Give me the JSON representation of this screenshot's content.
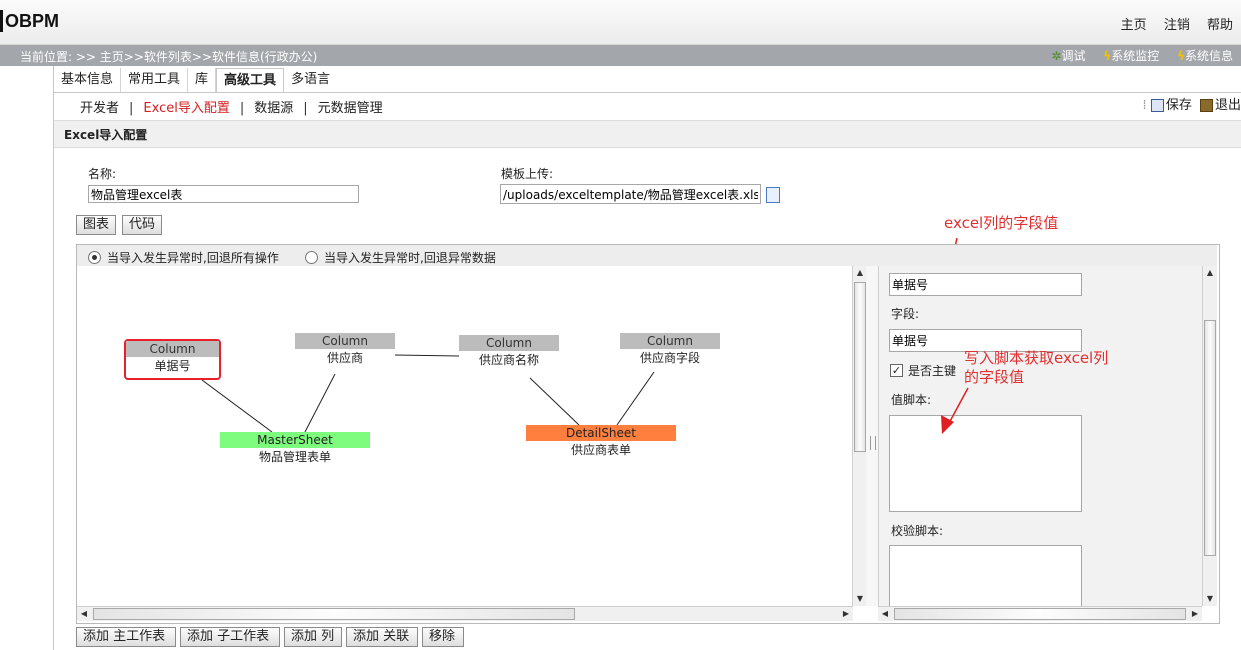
{
  "app": {
    "logo": "OBPM"
  },
  "header_links": [
    "主页",
    "注销",
    "帮助"
  ],
  "location": {
    "text": "当前位置: >> 主页>>软件列表>>软件信息(行政办公)"
  },
  "tools": {
    "debug": "调试",
    "monitor": "系统监控",
    "info": "系统信息"
  },
  "tabs": [
    "基本信息",
    "常用工具",
    "库",
    "高级工具",
    "多语言"
  ],
  "active_tab": "高级工具",
  "subnav": {
    "developer": "开发者",
    "excel_import": "Excel导入配置",
    "datasource": "数据源",
    "metadata": "元数据管理"
  },
  "actions": {
    "save": "保存",
    "exit": "退出"
  },
  "section_title": "Excel导入配置",
  "form": {
    "name_label": "名称:",
    "name_value": "物品管理excel表",
    "template_label": "模板上传:",
    "template_value": "/uploads/exceltemplate/物品管理excel表.xls"
  },
  "view_buttons": {
    "chart": "图表",
    "code": "代码"
  },
  "rollback": {
    "option_all": "当导入发生异常时,回退所有操作",
    "option_abnormal": "当导入发生异常时,回退异常数据",
    "selected": "all"
  },
  "diagram": {
    "columns": [
      {
        "header": "Column",
        "label": "单据号",
        "selected": true
      },
      {
        "header": "Column",
        "label": "供应商"
      },
      {
        "header": "Column",
        "label": "供应商名称"
      },
      {
        "header": "Column",
        "label": "供应商字段"
      }
    ],
    "master_sheet": {
      "type": "MasterSheet",
      "label": "物品管理表单",
      "color": "#7dfc7d"
    },
    "detail_sheet": {
      "type": "DetailSheet",
      "label": "供应商表单",
      "color": "#ff7f3f"
    },
    "selection_color": "#e8202a"
  },
  "properties": {
    "column_value": "单据号",
    "field_label": "字段:",
    "field_value": "单据号",
    "primary_key_label": "是否主键",
    "primary_key_checked": true,
    "value_script_label": "值脚本:",
    "validate_script_label": "校验脚本:"
  },
  "annotations": {
    "excel_field_value": "excel列的字段值",
    "script_line1": "写入脚本获取excel列",
    "script_line2": "的字段值"
  },
  "bottom_buttons": {
    "add_master": "添加 主工作表",
    "add_sub": "添加 子工作表",
    "add_column": "添加 列",
    "add_relation": "添加 关联",
    "remove": "移除"
  }
}
